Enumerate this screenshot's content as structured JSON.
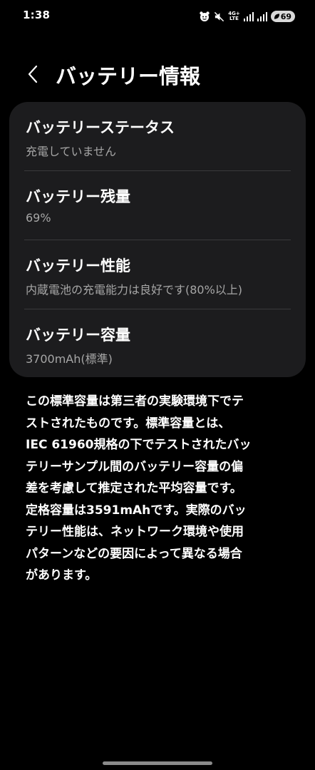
{
  "status_bar": {
    "time": "1:38",
    "network_top": "4G+",
    "network_bottom": "LTE",
    "battery_level": "69"
  },
  "header": {
    "title": "バッテリー情報"
  },
  "items": [
    {
      "title": "バッテリーステータス",
      "subtitle": "充電していません"
    },
    {
      "title": "バッテリー残量",
      "subtitle": "69%"
    },
    {
      "title": "バッテリー性能",
      "subtitle": "内蔵電池の充電能力は良好です(80%以上)"
    },
    {
      "title": "バッテリー容量",
      "subtitle": "3700mAh(標準)"
    }
  ],
  "description": {
    "lines": [
      "この標準容量は第三者の実験環境下でテ",
      "ストされたものです。標準容量とは、",
      "IEC 61960規格の下でテストされたバッ",
      "テリーサンプル間のバッテリー容量の偏",
      "差を考慮して推定された平均容量です。",
      "定格容量は3591mAhです。実際のバッ",
      "テリー性能は、ネットワーク環境や使用",
      "パターンなどの要因によって異なる場合",
      "があります。"
    ]
  },
  "icons": {
    "back": "chevron-left-icon",
    "app_notification": "face-icon",
    "mute": "mute-icon",
    "signal": "signal-icon",
    "battery": "leaf-battery-icon"
  },
  "colors": {
    "background": "#000000",
    "card": "#1c1c1e",
    "divider": "#3a3a3c",
    "subtitle": "#a6a6a6",
    "text": "#ffffff"
  }
}
